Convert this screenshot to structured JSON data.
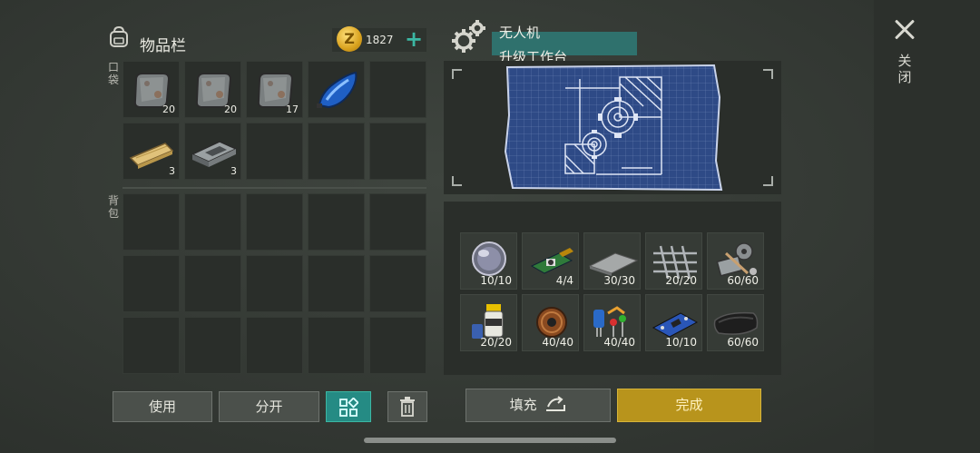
{
  "header": {
    "close_label": "关闭",
    "inventory_title": "物品栏",
    "coins": "1827",
    "coin_symbol": "Z",
    "plus_symbol": "+"
  },
  "inventory": {
    "pocket_label": "口袋",
    "backpack_label": "背包",
    "pocket_slots": [
      {
        "item": "metal-plate-icon",
        "count": "20"
      },
      {
        "item": "metal-plate-icon",
        "count": "20"
      },
      {
        "item": "metal-plate-icon",
        "count": "17"
      },
      {
        "item": "blue-fuel-tank-icon",
        "count": ""
      },
      {
        "item": "",
        "count": ""
      },
      {
        "item": "wood-plank-icon",
        "count": "3"
      },
      {
        "item": "iron-ingot-icon",
        "count": "3"
      },
      {
        "item": "",
        "count": ""
      },
      {
        "item": "",
        "count": ""
      },
      {
        "item": "",
        "count": ""
      }
    ],
    "backpack_slots": 15
  },
  "buttons": {
    "use": "使用",
    "split": "分开",
    "fill": "填充",
    "done": "完成"
  },
  "craft": {
    "title": "无人机",
    "subtitle": "升级工作台",
    "requirements": [
      {
        "item": "lens-icon",
        "count": "10/10"
      },
      {
        "item": "circuit-board-icon",
        "count": "4/4"
      },
      {
        "item": "steel-sheet-icon",
        "count": "30/30"
      },
      {
        "item": "wire-mesh-icon",
        "count": "20/20"
      },
      {
        "item": "mechanical-parts-icon",
        "count": "60/60"
      },
      {
        "item": "resin-bottle-icon",
        "count": "20/20"
      },
      {
        "item": "copper-wire-coil-icon",
        "count": "40/40"
      },
      {
        "item": "electronic-components-icon",
        "count": "40/40"
      },
      {
        "item": "microchip-icon",
        "count": "10/10"
      },
      {
        "item": "leather-icon",
        "count": "60/60"
      }
    ]
  },
  "colors": {
    "accent_teal": "#258b84",
    "done_gold": "#b8941c",
    "panel_dark": "#2a2e2a"
  }
}
